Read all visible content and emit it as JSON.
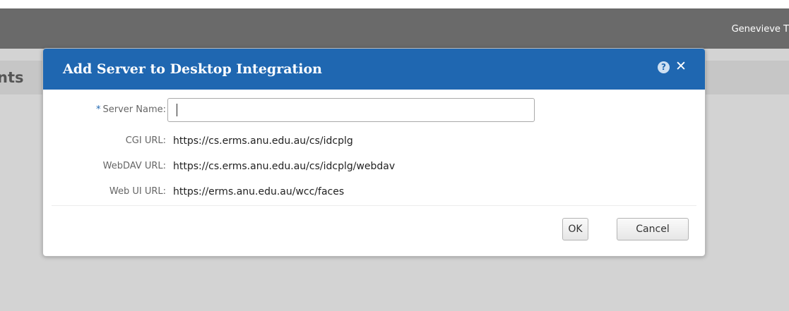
{
  "topbar": {
    "user_name": "Genevieve T"
  },
  "page": {
    "title_fragment": "nts"
  },
  "dialog": {
    "title": "Add Server to Desktop Integration",
    "help_icon": "help-icon",
    "close_icon": "close-icon",
    "fields": {
      "server_name": {
        "label": "Server Name:",
        "required_marker": "*",
        "value": ""
      },
      "cgi_url": {
        "label": "CGI URL:",
        "value": "https://cs.erms.anu.edu.au/cs/idcplg"
      },
      "webdav_url": {
        "label": "WebDAV URL:",
        "value": "https://cs.erms.anu.edu.au/cs/idcplg/webdav"
      },
      "webui_url": {
        "label": "Web UI URL:",
        "value": "https://erms.anu.edu.au/wcc/faces"
      }
    },
    "buttons": {
      "ok": "OK",
      "cancel": "Cancel"
    }
  },
  "colors": {
    "header_blue": "#1f67b1",
    "topbar_gray": "#6a6a6a",
    "backdrop_gray": "#d3d3d3"
  }
}
